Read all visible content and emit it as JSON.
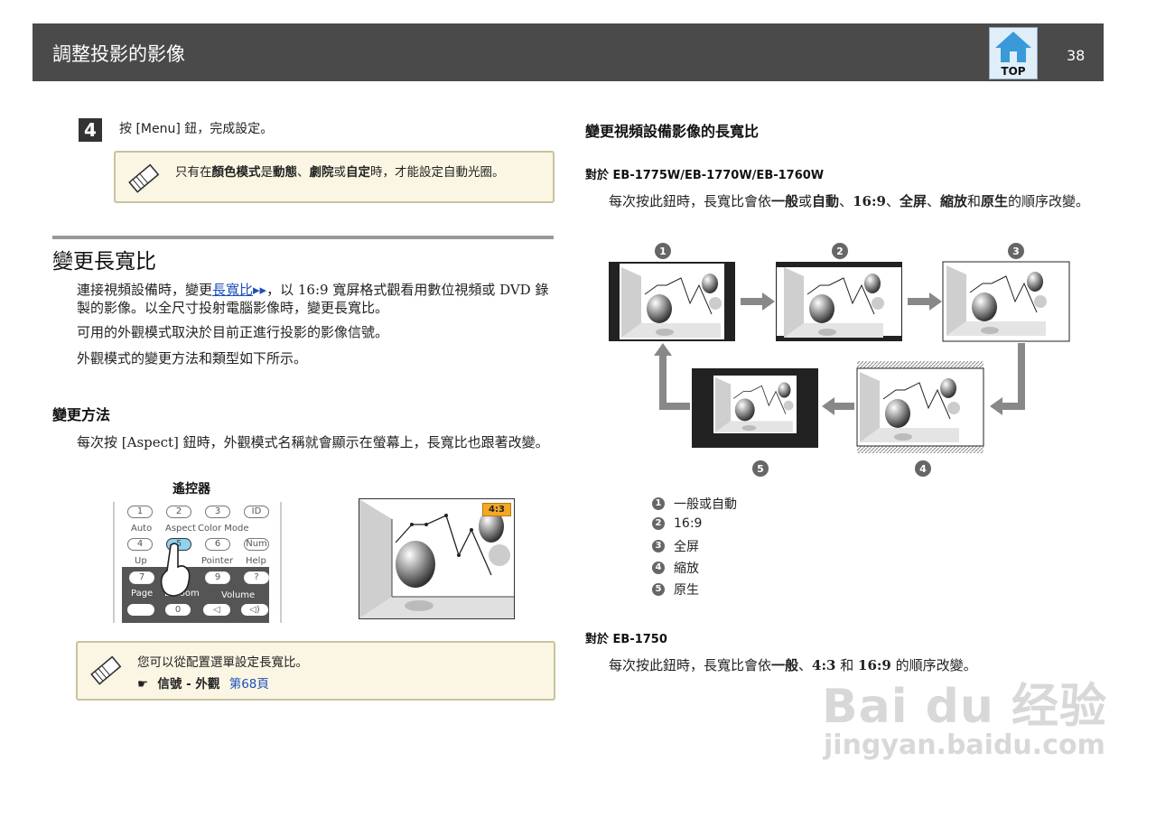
{
  "header": {
    "title": "調整投影的影像",
    "page_number": "38",
    "top_label": "TOP"
  },
  "left": {
    "step": {
      "number": "4",
      "text": "按 [Menu] 鈕，完成設定。"
    },
    "note1": {
      "parts": [
        "只有在",
        "顏色模式",
        "是",
        "動態",
        "、",
        "劇院",
        "或",
        "自定",
        "時，才能設定自動光圈。"
      ]
    },
    "section_title": "變更長寬比",
    "para1": {
      "before": "連接視頻設備時，變更",
      "link": "長寬比",
      "after": "，以 16:9 寬屏格式觀看用數位視頻或 DVD 錄製的影像。以全尺寸投射電腦影像時，變更長寬比。"
    },
    "para2": "可用的外觀模式取決於目前正進行投影的影像信號。",
    "para3": "外觀模式的變更方法和類型如下所示。",
    "method_title": "變更方法",
    "method_text": "每次按 [Aspect] 鈕時，外觀模式名稱就會顯示在螢幕上，長寬比也跟著改變。",
    "remote": {
      "title": "遙控器",
      "row1": [
        "1",
        "2",
        "3",
        "ID"
      ],
      "labels1": [
        "Auto",
        "Aspect",
        "Color Mode"
      ],
      "row2": [
        "4",
        "5",
        "6",
        "Num"
      ],
      "labels2": [
        "Up",
        "Pointer",
        "Help"
      ],
      "row3": [
        "7",
        "9",
        "?"
      ],
      "labels3": [
        "Page",
        "E-Zoom",
        "Volume"
      ],
      "row4": [
        "0"
      ]
    },
    "screen_badge": "4:3",
    "note2": {
      "text": "您可以從配置選單設定長寬比。",
      "ref_bold": "信號 - 外觀",
      "ref_link": "第68頁"
    }
  },
  "right": {
    "title": "變更視頻設備影像的長寬比",
    "model1": "對於 EB-1775W/EB-1770W/EB-1760W",
    "text1_parts": [
      "每次按此鈕時，長寬比會依",
      "一般",
      "或",
      "自動",
      "、",
      "16:9",
      "、",
      "全屏",
      "、",
      "縮放",
      "和",
      "原生",
      "的順序改變。"
    ],
    "diagram_markers": [
      "1",
      "2",
      "3",
      "4",
      "5"
    ],
    "legend": [
      {
        "num": "1",
        "text": "一般或自動"
      },
      {
        "num": "2",
        "text": "16:9"
      },
      {
        "num": "3",
        "text": "全屏"
      },
      {
        "num": "4",
        "text": "縮放"
      },
      {
        "num": "5",
        "text": "原生"
      }
    ],
    "model2": "對於 EB-1750",
    "text2_parts": [
      "每次按此鈕時，長寬比會依",
      "一般",
      "、",
      "4:3",
      " 和 ",
      "16:9",
      " 的順序改變。"
    ]
  },
  "watermark": {
    "line1": "Bai du 经验",
    "line2": "jingyan.baidu.com"
  }
}
